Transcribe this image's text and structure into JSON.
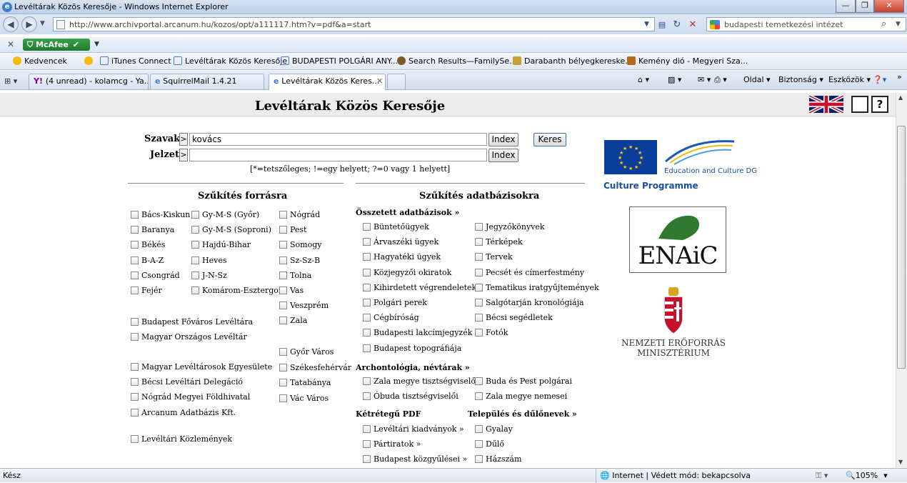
{
  "window": {
    "title": "Levéltárak Közös Keresője - Windows Internet Explorer",
    "url": "http://www.archivportal.arcanum.hu/kozos/opt/a111117.htm?v=pdf&a=start",
    "search_value": "budapesti temetkezési intézet"
  },
  "toolbar": {
    "mcafee_label": "McAfee",
    "close_x": "✕"
  },
  "favorites": [
    "Kedvencek",
    "iTunes Connect",
    "Levéltárak Közös Keresője",
    "BUDAPESTI POLGÁRI ANY...",
    "Search Results—FamilySe...",
    "Darabanth bélyegkereske...",
    "Kemény dió - Megyeri Sza..."
  ],
  "tabs": [
    "(4 unread) - kolamcg - Ya...",
    "SquirrelMail 1.4.21",
    "Levéltárak Közös Keres..."
  ],
  "commands": {
    "oldal": "Oldal ▾",
    "biztonsag": "Biztonság ▾",
    "eszkozok": "Eszközök ▾"
  },
  "page": {
    "title": "Levéltárak Közös Keresője",
    "help_label": "?",
    "szavak_label": "Szavak",
    "szavak_value": "kovács",
    "jelzet_label": "Jelzet",
    "jelzet_value": "",
    "arrow": ">",
    "index_label": "Index",
    "keres_label": "Keres",
    "hint": "[*=tetszőleges; !=egy helyett; ?=0 vagy 1 helyett]",
    "forras_title": "Szűkítés forrásra",
    "adatbazis_title": "Szűkítés adatbázisokra",
    "forras_col1": [
      "Bács-Kiskun",
      "Baranya",
      "Békés",
      "B-A-Z",
      "Csongrád",
      "Fejér"
    ],
    "forras_col2": [
      "Gy-M-S (Győr)",
      "Gy-M-S (Soproni)",
      "Hajdú-Bihar",
      "Heves",
      "J-N-Sz",
      "Komárom-Esztergom"
    ],
    "forras_col3": [
      "Nógrád",
      "Pest",
      "Somogy",
      "Sz-Sz-B",
      "Tolna",
      "Vas",
      "Veszprém",
      "Zala"
    ],
    "forras_lev": [
      "Budapest Főváros Levéltára",
      "Magyar Országos Levéltár"
    ],
    "forras_varos": [
      "Győr Város",
      "Székesfehérvár",
      "Tatabánya",
      "Vác Város"
    ],
    "forras_egyeb": [
      "Magyar Levéltárosok Egyesülete",
      "Bécsi Levéltári Delegáció",
      "Nógrád Megyei Földhivatal",
      "Arcanum Adatbázis Kft."
    ],
    "forras_kozl": "Levéltári Közlemények",
    "osszetett_title": "Összetett adatbázisok »",
    "osszetett_col1": [
      "Büntetőügyek",
      "Árvaszéki ügyek",
      "Hagyatéki ügyek",
      "Közjegyzői okiratok",
      "Kihirdetett végrendeletek",
      "Polgári perek",
      "Cégbíróság",
      "Budapesti lakcímjegyzék",
      "Budapest topográfiája"
    ],
    "osszetett_col2": [
      "Jegyzőkönyvek",
      "Térképek",
      "Tervek",
      "Pecsét és címerfestmény",
      "Tematikus iratgyűjtemények",
      "Salgótarján kronológiája",
      "Bécsi segédletek",
      "Fotók"
    ],
    "archontologia_title": "Archontológia, névtárak »",
    "archontologia_col1": [
      "Zala megye tisztségviselői",
      "Óbuda tisztségviselői"
    ],
    "archontologia_col2": [
      "Buda és Pest polgárai",
      "Zala megye nemesei"
    ],
    "pdf_title": "Kétrétegű PDF",
    "pdf_items": [
      "Levéltári kiadványok »",
      "Pártiratok »",
      "Budapest közgyűlései »"
    ],
    "telepules_title": "Település és dűlőnevek »",
    "telepules_items": [
      "Gyalay",
      "Dűlő",
      "Házszám"
    ],
    "eu_caption": "Education and Culture DG",
    "culture_programme": "Culture Programme",
    "enaic": "ENAiC",
    "ministry_line1": "NEMZETI ERŐFORRÁS",
    "ministry_line2": "MINISZTÉRIUM"
  },
  "status": {
    "left": "Kész",
    "zone": "Internet | Védett mód: bekapcsolva",
    "zoom": "105%"
  }
}
